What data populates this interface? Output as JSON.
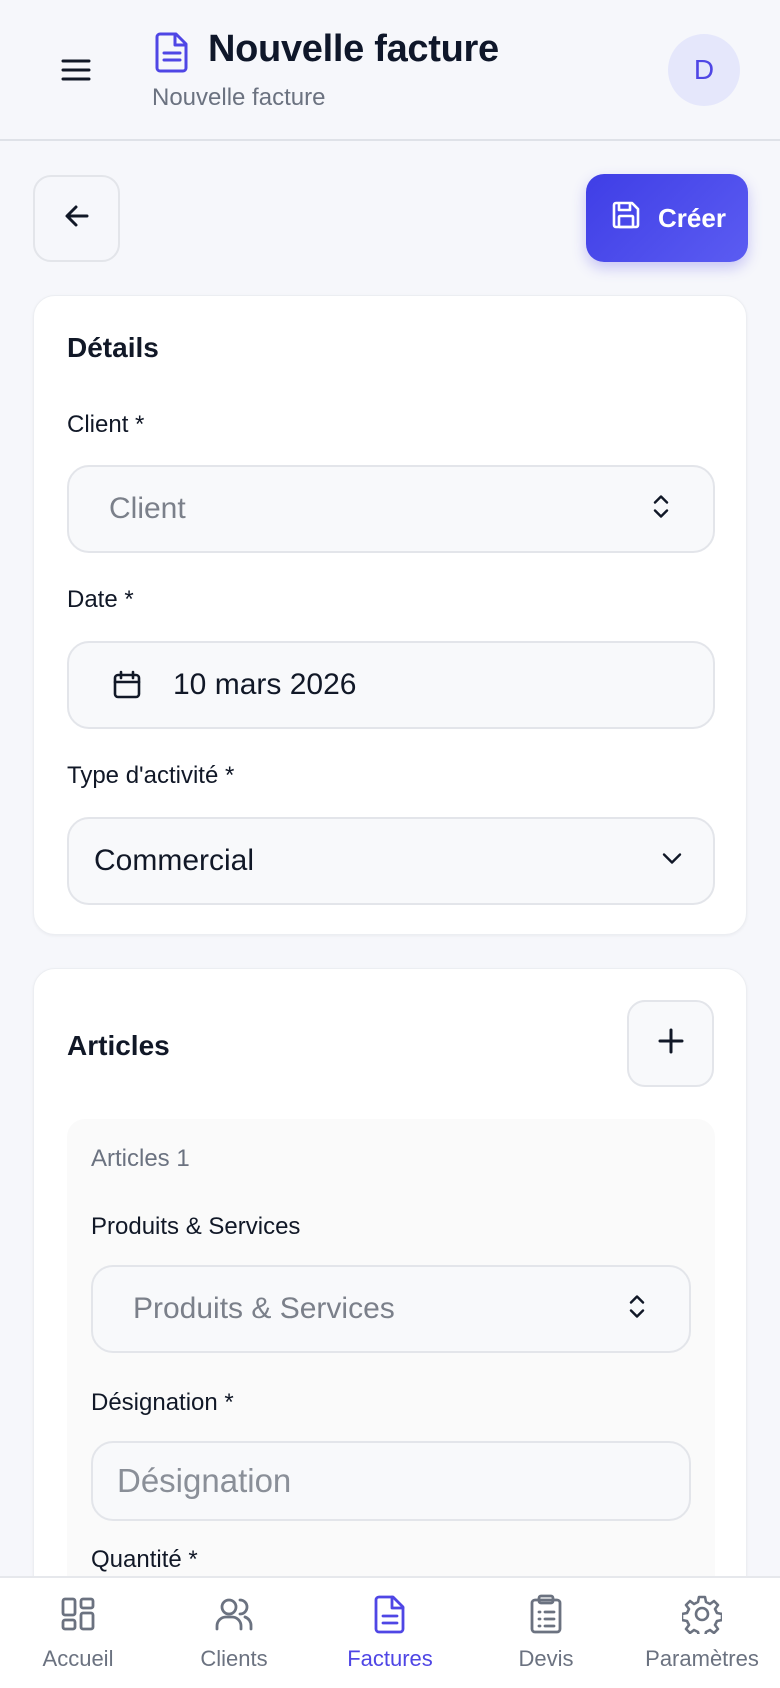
{
  "header": {
    "title": "Nouvelle facture",
    "subtitle": "Nouvelle facture",
    "avatar_initial": "D",
    "menu_icon": "hamburger-menu-icon",
    "title_icon": "file-text-icon"
  },
  "actions": {
    "back_icon": "arrow-left-icon",
    "create_label": "Créer",
    "create_icon": "save-icon"
  },
  "details": {
    "title": "Détails",
    "client": {
      "label": "Client *",
      "placeholder": "Client"
    },
    "date": {
      "label": "Date *",
      "value": "10 mars 2026"
    },
    "activity": {
      "label": "Type d'activité *",
      "value": "Commercial"
    }
  },
  "articles": {
    "title": "Articles",
    "add_icon": "plus-icon",
    "item": {
      "heading": "Articles 1",
      "products": {
        "label": "Produits & Services",
        "placeholder": "Produits & Services"
      },
      "designation": {
        "label": "Désignation *",
        "placeholder": "Désignation"
      },
      "quantity": {
        "label": "Quantité *"
      }
    }
  },
  "nav": {
    "items": [
      {
        "label": "Accueil",
        "icon": "dashboard-icon",
        "active": false
      },
      {
        "label": "Clients",
        "icon": "users-icon",
        "active": false
      },
      {
        "label": "Factures",
        "icon": "file-text-icon",
        "active": true
      },
      {
        "label": "Devis",
        "icon": "clipboard-list-icon",
        "active": false
      },
      {
        "label": "Paramètres",
        "icon": "gear-icon",
        "active": false
      }
    ]
  },
  "colors": {
    "accent": "#4f46e5",
    "background": "#f6f7fb",
    "card": "#ffffff",
    "muted_text": "#6b7280"
  }
}
